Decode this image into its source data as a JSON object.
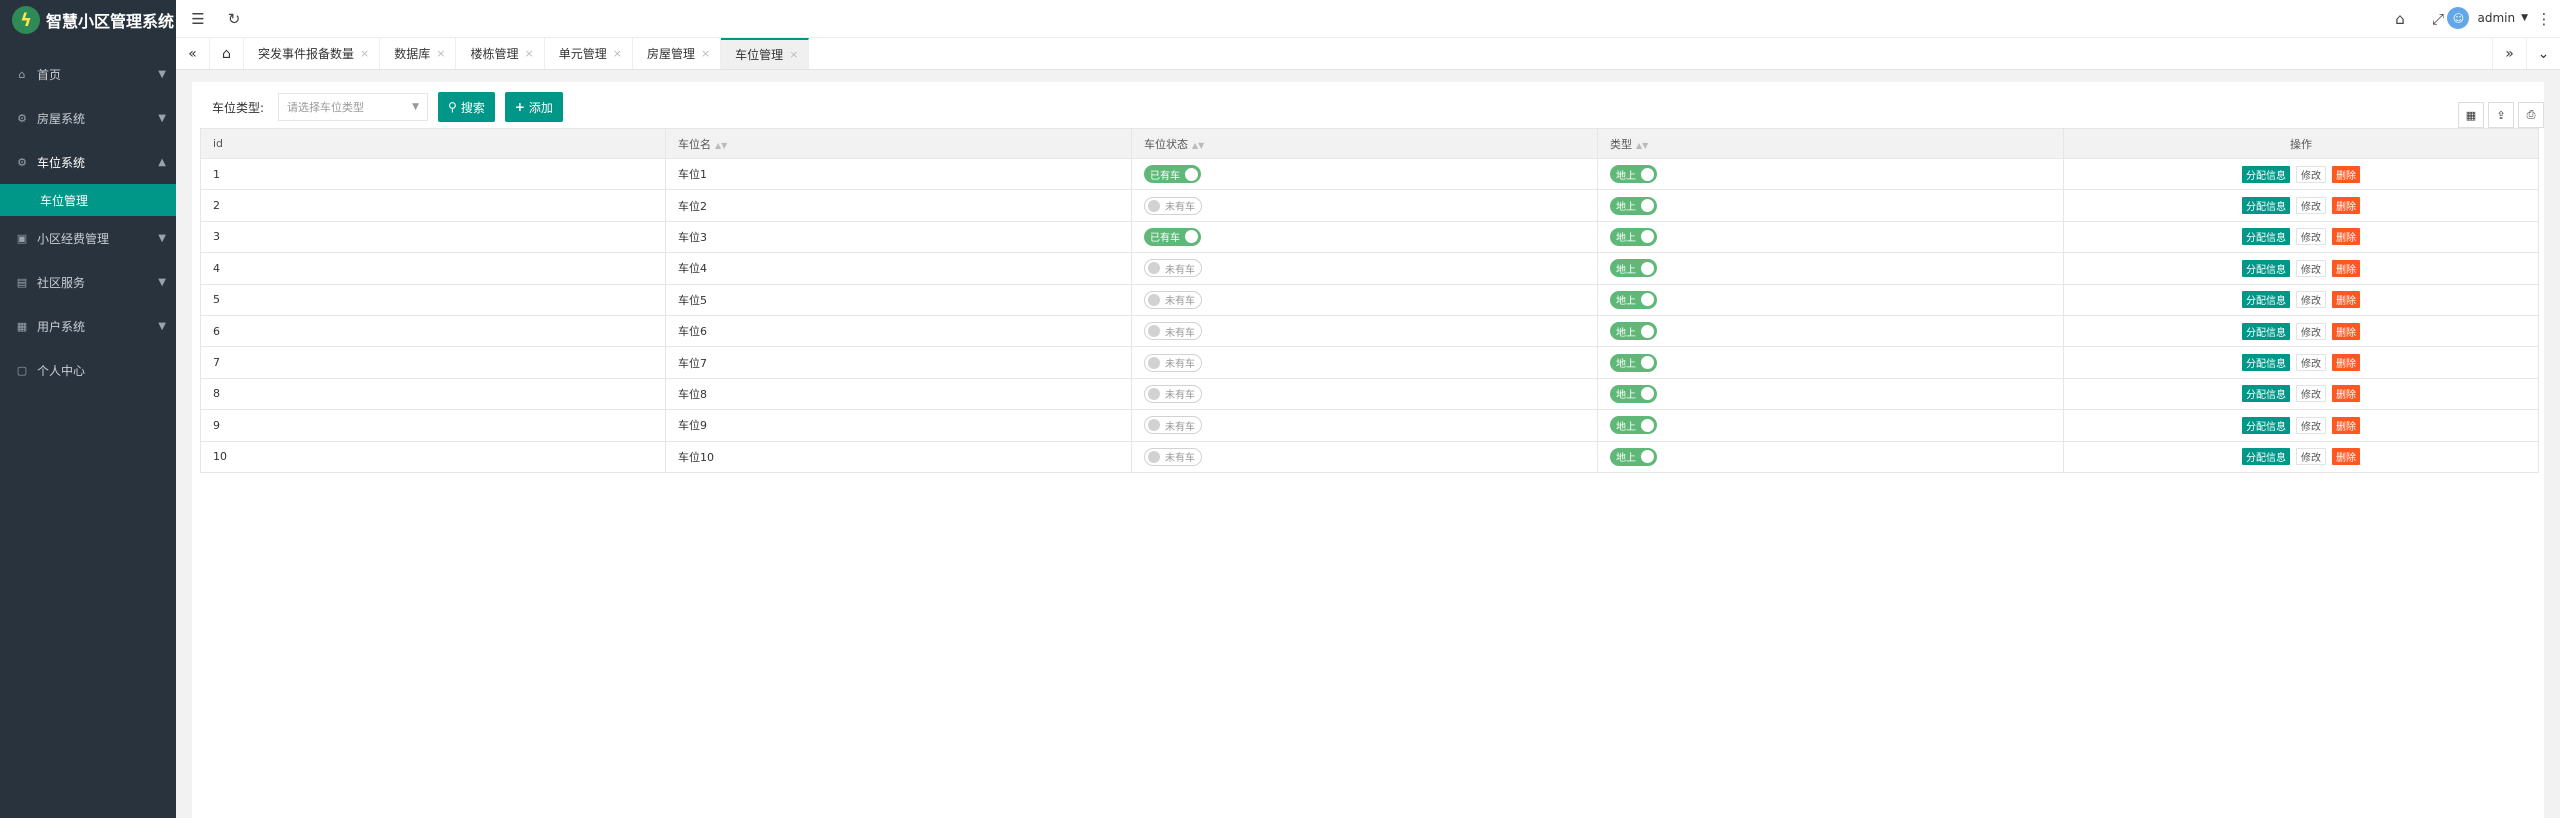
{
  "app": {
    "title": "智慧小区管理系统"
  },
  "sidebar": {
    "items": [
      {
        "label": "首页",
        "icon": "home-icon",
        "expand": "chevron-down"
      },
      {
        "label": "房屋系统",
        "icon": "settings-icon",
        "expand": "chevron-down"
      },
      {
        "label": "车位系统",
        "icon": "settings-icon",
        "expand": "chevron-up",
        "submenu": [
          "车位管理"
        ]
      },
      {
        "label": "小区经费管理",
        "icon": "wallet-icon",
        "expand": "chevron-down"
      },
      {
        "label": "社区服务",
        "icon": "chart-icon",
        "expand": "chevron-down"
      },
      {
        "label": "用户系统",
        "icon": "user-doc-icon",
        "expand": "chevron-down"
      },
      {
        "label": "个人中心",
        "icon": "page-icon",
        "expand": ""
      }
    ]
  },
  "header": {
    "username": "admin"
  },
  "tabs": [
    "突发事件报备数量",
    "数据库",
    "楼栋管理",
    "单元管理",
    "房屋管理",
    "车位管理"
  ],
  "active_tab": "车位管理",
  "filter": {
    "label": "车位类型:",
    "placeholder": "请选择车位类型",
    "search_label": "搜索",
    "add_label": "添加"
  },
  "table": {
    "columns": [
      "id",
      "车位名",
      "车位状态",
      "类型",
      "操作"
    ],
    "rows": [
      {
        "id": "1",
        "name": "车位1",
        "status": "已有车",
        "status_on": true,
        "type": "地上"
      },
      {
        "id": "2",
        "name": "车位2",
        "status": "未有车",
        "status_on": false,
        "type": "地上"
      },
      {
        "id": "3",
        "name": "车位3",
        "status": "已有车",
        "status_on": true,
        "type": "地上"
      },
      {
        "id": "4",
        "name": "车位4",
        "status": "未有车",
        "status_on": false,
        "type": "地上"
      },
      {
        "id": "5",
        "name": "车位5",
        "status": "未有车",
        "status_on": false,
        "type": "地上"
      },
      {
        "id": "6",
        "name": "车位6",
        "status": "未有车",
        "status_on": false,
        "type": "地上"
      },
      {
        "id": "7",
        "name": "车位7",
        "status": "未有车",
        "status_on": false,
        "type": "地上"
      },
      {
        "id": "8",
        "name": "车位8",
        "status": "未有车",
        "status_on": false,
        "type": "地上"
      },
      {
        "id": "9",
        "name": "车位9",
        "status": "未有车",
        "status_on": false,
        "type": "地上"
      },
      {
        "id": "10",
        "name": "车位10",
        "status": "未有车",
        "status_on": false,
        "type": "地上"
      }
    ],
    "actions": {
      "assign": "分配信息",
      "edit": "修改",
      "delete": "删除"
    }
  },
  "colors": {
    "sidebar_bg": "#28333e",
    "accent": "#009688",
    "switch_on": "#5fb878",
    "danger": "#ff5722"
  }
}
